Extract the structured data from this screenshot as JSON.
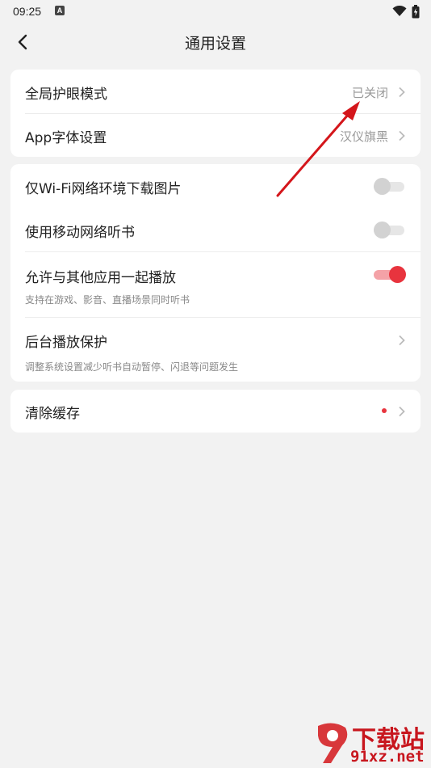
{
  "status_bar": {
    "time": "09:25",
    "notif_badge": "A"
  },
  "header": {
    "title": "通用设置"
  },
  "card1": {
    "rows": [
      {
        "title": "全局护眼模式",
        "value": "已关闭"
      },
      {
        "title": "App字体设置",
        "value": "汉仪旗黑"
      }
    ]
  },
  "card2": {
    "rows": [
      {
        "title": "仅Wi-Fi网络环境下载图片",
        "toggle": "off"
      },
      {
        "title": "使用移动网络听书",
        "toggle": "off"
      },
      {
        "title": "允许与其他应用一起播放",
        "subtitle": "支持在游戏、影音、直播场景同时听书",
        "toggle": "on"
      },
      {
        "title": "后台播放保护",
        "subtitle": "调整系统设置减少听书自动暂停、闪退等问题发生"
      }
    ]
  },
  "card3": {
    "rows": [
      {
        "title": "清除缓存",
        "has_dot": true
      }
    ]
  },
  "watermark": {
    "title": "下载站",
    "url": "91xz.net"
  },
  "colors": {
    "accent": "#e8343e",
    "background": "#f2f2f2",
    "annotation_arrow": "#d4161b"
  }
}
